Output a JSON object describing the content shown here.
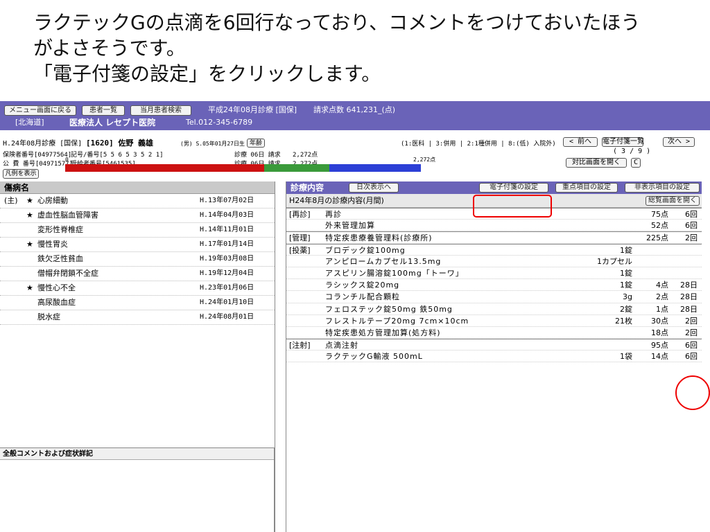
{
  "instruction": {
    "line1": "ラクテックGの点滴を6回行なっており、コメントをつけておいたほう",
    "line2": "がよさそうです。",
    "line3": "「電子付箋の設定」をクリックします。"
  },
  "header": {
    "buttons": [
      "メニュー画面に戻る",
      "患者一覧",
      "当月患者検索"
    ],
    "billing_period": "平成24年08月診療 [国保]",
    "claim_points": "請求点数 641,231_(点)",
    "prefecture": "[北海道]",
    "clinic_name": "医療法人 レセプト医院",
    "tel": "Tel.012-345-6789"
  },
  "patient": {
    "line1_left": "H.24年08月診療 [国保]",
    "id_name": "[1620] 佐野 義雄",
    "sex_dob": "(男) S.05年01月27日生",
    "age_button": "年齢",
    "insurer": "保険者番号[04977564]",
    "card_no": "記号/番号[5 5 6 5 3 5 2 1]",
    "public_no": "公 費 番号[04971577]",
    "recipient_no": "受給者番号[5461535]",
    "days1": "診療 06日 請求",
    "points1": "2,272点",
    "days2": "診療 06日 請求",
    "points2": "2,272点",
    "category_info": "(1:医科 | 3:併用 | 2:1種併用 | 8:(低) 入院外)",
    "prev_button": "< 前へ",
    "sticky_list_button": "電子付箋一覧",
    "next_button": "次へ >",
    "pager": "( 3 / 9 )",
    "compare_button": "対比画面を開く",
    "c_button": "C",
    "legend_button": "凡例を表示",
    "bar_start": "0",
    "bar_end": "2,272点"
  },
  "diseases": {
    "title": "傷病名",
    "rows": [
      {
        "prefix": "(主)",
        "star": "★",
        "name": "心房細動",
        "date": "H.13年07月02日"
      },
      {
        "prefix": "",
        "star": "★",
        "name": "虚血性脳血管障害",
        "date": "H.14年04月03日"
      },
      {
        "prefix": "",
        "star": "",
        "name": "変形性脊椎症",
        "date": "H.14年11月01日"
      },
      {
        "prefix": "",
        "star": "★",
        "name": "慢性胃炎",
        "date": "H.17年01月14日"
      },
      {
        "prefix": "",
        "star": "",
        "name": "鉄欠乏性貧血",
        "date": "H.19年03月08日"
      },
      {
        "prefix": "",
        "star": "",
        "name": "僧帽弁閉鎖不全症",
        "date": "H.19年12月04日"
      },
      {
        "prefix": "",
        "star": "★",
        "name": "慢性心不全",
        "date": "H.23年01月06日"
      },
      {
        "prefix": "",
        "star": "",
        "name": "高尿酸血症",
        "date": "H.24年01月10日"
      },
      {
        "prefix": "",
        "star": "",
        "name": "脱水症",
        "date": "H.24年08月01日"
      }
    ],
    "comment_title": "全般コメントおよび症状詳記"
  },
  "treatment": {
    "title": "診療内容",
    "daily_button": "日次表示へ",
    "sticky_button": "電子付箋の設定",
    "priority_button": "重点項目の設定",
    "hidden_button": "非表示項目の設定",
    "month_label": "H24年8月の診療内容(月間)",
    "overview_button": "総覧画面を開く",
    "rows": [
      {
        "cat": "[再診]",
        "item": "再診",
        "qty": "",
        "pts": "75点",
        "cnt": "6回",
        "sect": true
      },
      {
        "cat": "",
        "item": "外来管理加算",
        "qty": "",
        "pts": "52点",
        "cnt": "6回",
        "sect": false
      },
      {
        "cat": "[管理]",
        "item": "特定疾患療養管理料(診療所)",
        "qty": "",
        "pts": "225点",
        "cnt": "2回",
        "sect": true
      },
      {
        "cat": "[投薬]",
        "item": "ブロデック錠100mg",
        "qty": "1錠",
        "pts": "",
        "cnt": "",
        "sect": true
      },
      {
        "cat": "",
        "item": "アンピロームカプセル13.5mg",
        "qty": "1カプセル",
        "pts": "",
        "cnt": "",
        "sect": false
      },
      {
        "cat": "",
        "item": "アスピリン腸溶錠100mg「トーワ」",
        "qty": "1錠",
        "pts": "",
        "cnt": "",
        "sect": false
      },
      {
        "cat": "",
        "item": "ラシックス錠20mg",
        "qty": "1錠",
        "pts": "4点",
        "cnt": "28日",
        "sect": false
      },
      {
        "cat": "",
        "item": "コランチル配合顆粒",
        "qty": "3g",
        "pts": "2点",
        "cnt": "28日",
        "sect": false
      },
      {
        "cat": "",
        "item": "フェロステック錠50mg 鉄50mg",
        "qty": "2錠",
        "pts": "1点",
        "cnt": "28日",
        "sect": false
      },
      {
        "cat": "",
        "item": "フレストルテープ20mg 7cm×10cm",
        "qty": "21枚",
        "pts": "30点",
        "cnt": "2回",
        "sect": false
      },
      {
        "cat": "",
        "item": "特定疾患処方管理加算(処方料)",
        "qty": "",
        "pts": "18点",
        "cnt": "2回",
        "sect": false
      },
      {
        "cat": "[注射]",
        "item": "点滴注射",
        "qty": "",
        "pts": "95点",
        "cnt": "6回",
        "sect": true
      },
      {
        "cat": "",
        "item": "ラクテックG輸液 500mL",
        "qty": "1袋",
        "pts": "14点",
        "cnt": "6回",
        "sect": false
      }
    ]
  },
  "colors": {
    "header_bg": "#6a63b8",
    "bar_red": "#cc1111",
    "bar_green": "#3a9a3a",
    "bar_blue": "#2c3fd6",
    "highlight": "#e00000"
  }
}
